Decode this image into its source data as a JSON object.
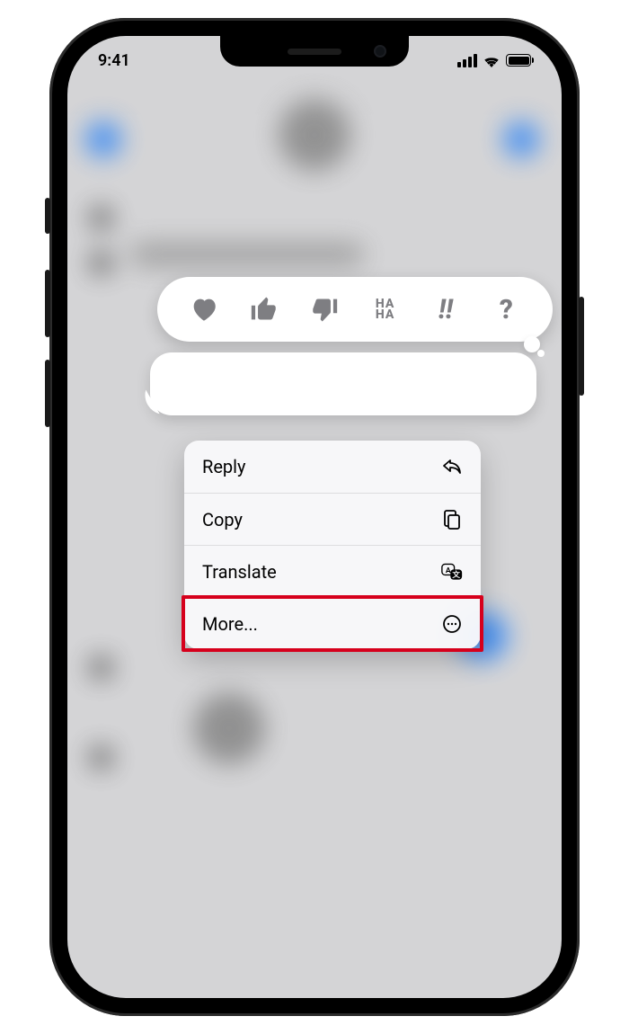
{
  "status": {
    "time": "9:41"
  },
  "tapbacks": {
    "heart": "heart",
    "thumbs_up": "thumbs-up",
    "thumbs_down": "thumbs-down",
    "haha_top": "HA",
    "haha_bottom": "HA",
    "emphasis": "!!",
    "question": "?"
  },
  "menu": {
    "items": [
      {
        "label": "Reply",
        "icon": "reply-arrow-icon"
      },
      {
        "label": "Copy",
        "icon": "copy-pages-icon"
      },
      {
        "label": "Translate",
        "icon": "translate-icon"
      },
      {
        "label": "More...",
        "icon": "more-ellipsis-icon",
        "highlighted": true
      }
    ]
  }
}
